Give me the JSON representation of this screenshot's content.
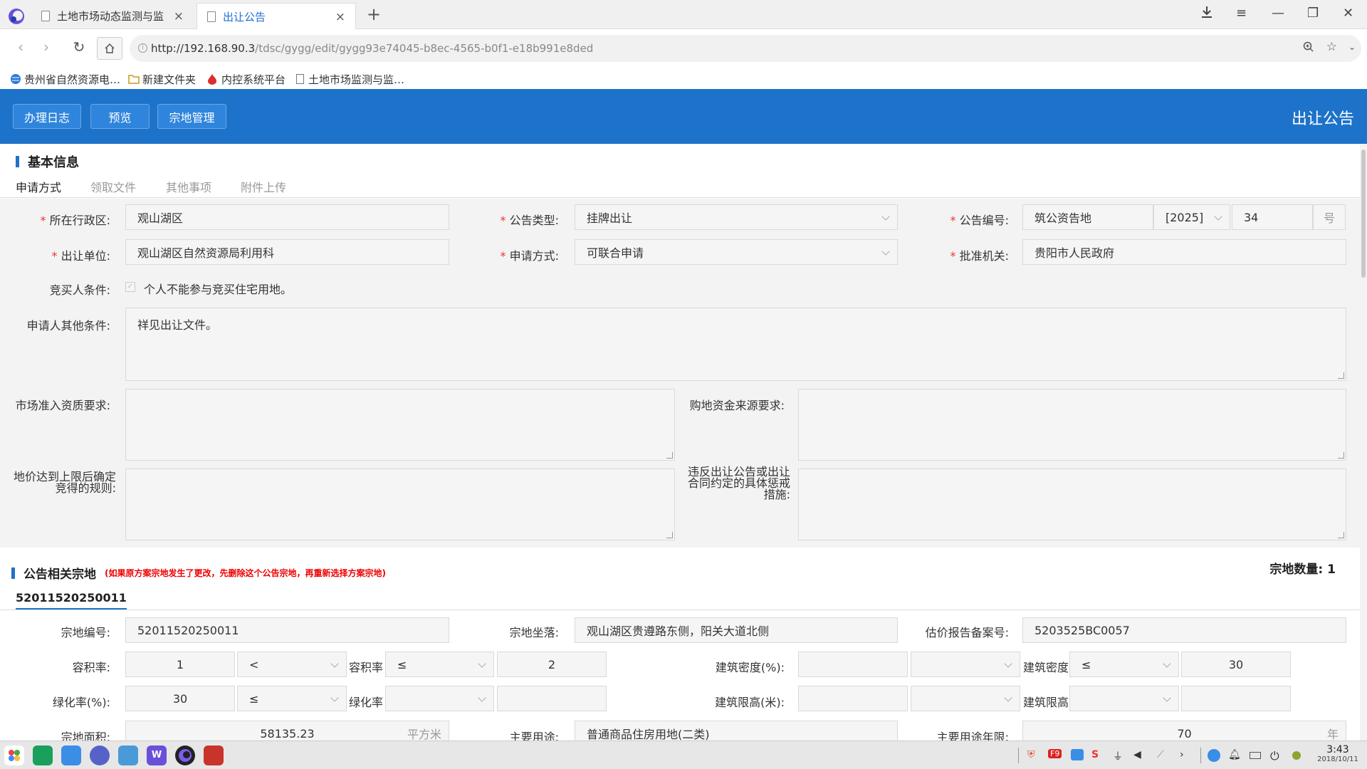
{
  "browser": {
    "tabs": [
      {
        "title": "土地市场动态监测与监管"
      },
      {
        "title": "出让公告"
      }
    ],
    "url_host": "http://192.168.90.3",
    "url_path": "/tdsc/gygg/edit/gygg93e74045-b8ec-4565-b0f1-e18b991e8ded",
    "bookmarks": [
      "贵州省自然资源电…",
      "新建文件夹",
      "内控系统平台",
      "土地市场监测与监…"
    ]
  },
  "header": {
    "buttons": [
      "办理日志",
      "预览",
      "宗地管理"
    ],
    "title": "出让公告"
  },
  "basic": {
    "title": "基本信息",
    "tabs": [
      "申请方式",
      "领取文件",
      "其他事项",
      "附件上传"
    ],
    "fields": {
      "district_label": "所在行政区:",
      "district": "观山湖区",
      "type_label": "公告类型:",
      "type": "挂牌出让",
      "number_label": "公告编号:",
      "number_prefix": "筑公资告地",
      "number_year": "[2025]",
      "number_seq": "34",
      "number_suffix": "号",
      "unit_label": "出让单位:",
      "unit": "观山湖区自然资源局利用科",
      "method_label": "申请方式:",
      "method": "可联合申请",
      "approver_label": "批准机关:",
      "approver": "贵阳市人民政府",
      "bidder_label": "竞买人条件:",
      "bidder_text": "个人不能参与竞买住宅用地。",
      "other_label": "申请人其他条件:",
      "other": "祥见出让文件。",
      "market_label": "市场准入资质要求:",
      "fund_label": "购地资金来源要求:",
      "cap_label": "地价达到上限后确定竞得的规则:",
      "penalty_label": "违反出让公告或出让合同约定的具体惩戒措施:"
    }
  },
  "parcels": {
    "title": "公告相关宗地",
    "note": "(如果原方案宗地发生了更改，先删除这个公告宗地，再重新选择方案宗地)",
    "count_label": "宗地数量:",
    "count": "1",
    "tab": "52011520250011",
    "fields": {
      "code_label": "宗地编号:",
      "code": "52011520250011",
      "location_label": "宗地坐落:",
      "location": "观山湖区贵遵路东侧，阳关大道北侧",
      "report_label": "估价报告备案号:",
      "report": "5203525BC0057",
      "far_label": "容积率:",
      "far_min": "1",
      "far_op1": "<",
      "far_mid": "容积率",
      "far_op2": "≤",
      "far_max": "2",
      "density_label": "建筑密度(%):",
      "density_mid": "建筑密度",
      "density_op2": "≤",
      "density_max": "30",
      "green_label": "绿化率(%):",
      "green_min": "30",
      "green_op1": "≤",
      "green_mid": "绿化率",
      "height_label": "建筑限高(米):",
      "height_mid": "建筑限高",
      "area_label": "宗地面积:",
      "area": "58135.23",
      "area_unit": "平方米",
      "use_label": "主要用途:",
      "use": "普通商品住房用地(二类)",
      "term_label": "主要用途年限:",
      "term": "70",
      "term_unit": "年"
    }
  },
  "taskbar": {
    "time": "3:43",
    "date": "2018/10/11"
  }
}
